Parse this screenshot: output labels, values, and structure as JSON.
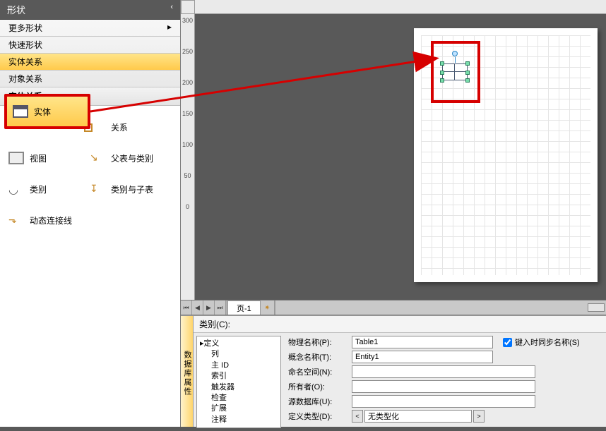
{
  "panel": {
    "title": "形状",
    "chevron": "‹"
  },
  "menu": {
    "items": [
      {
        "label": "更多形状"
      },
      {
        "label": "快速形状"
      },
      {
        "label": "实体关系",
        "active": true
      },
      {
        "label": "对象关系"
      }
    ]
  },
  "section": {
    "title": "实体关系"
  },
  "stencils": {
    "entity": "实体",
    "relation": "关系",
    "view": "视图",
    "parentchild": "父表与类别",
    "category": "类别",
    "catchild": "类别与子表",
    "dyn": "动态连接线"
  },
  "ruler_v": [
    "300",
    "250",
    "200",
    "150",
    "100",
    "50",
    "0"
  ],
  "pagetab": {
    "label": "页-1",
    "nav": [
      "⏮",
      "◀",
      "▶",
      "⏭"
    ],
    "new": "✷"
  },
  "props": {
    "sideTitle": "数据库属性",
    "catLabel": "类别(C):",
    "tree": {
      "root": "▸定义",
      "children": [
        "列",
        "主 ID",
        "索引",
        "触发器",
        "检查",
        "扩展",
        "注释"
      ]
    },
    "fields": {
      "physName": {
        "label": "物理名称(P):",
        "value": "Table1"
      },
      "syncChk": {
        "label": "键入时同步名称(S)",
        "checked": true
      },
      "concName": {
        "label": "概念名称(T):",
        "value": "Entity1"
      },
      "namespace": {
        "label": "命名空间(N):",
        "value": ""
      },
      "owner": {
        "label": "所有者(O):",
        "value": ""
      },
      "srcdb": {
        "label": "源数据库(U):",
        "value": ""
      },
      "deftype": {
        "label": "定义类型(D):",
        "value": "无类型化",
        "btnL": "<",
        "btnR": ">"
      }
    }
  }
}
